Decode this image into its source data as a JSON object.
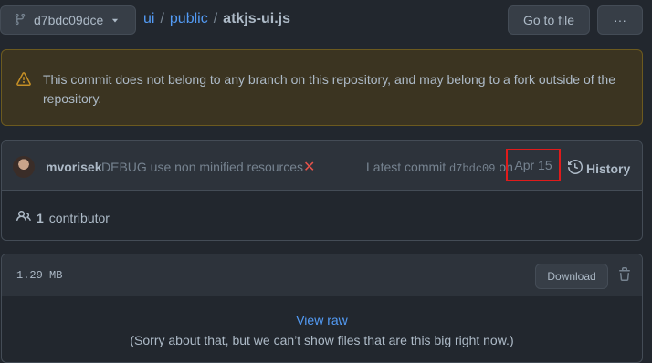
{
  "branch": {
    "label": "d7bdc09dce",
    "icon": "git-branch-icon"
  },
  "breadcrumb": {
    "repo": "ui",
    "sep": "/",
    "folder": "public",
    "file": "atkjs-ui.js"
  },
  "toolbar": {
    "goto_label": "Go to file",
    "more_label": "···"
  },
  "flash": {
    "text": "This commit does not belong to any branch on this repository, and may belong to a fork outside of the repository.",
    "icon": "alert-icon",
    "color": "#c69026"
  },
  "commit": {
    "author": "mvorisek",
    "message": "DEBUG use non minified resources",
    "status": "✕",
    "latest_prefix": "Latest commit",
    "sha": "d7bdc09",
    "on": "on",
    "date": "Apr 15",
    "history_label": "History"
  },
  "contributors": {
    "count": "1",
    "label": "contributor"
  },
  "file": {
    "size": "1.29 MB",
    "download_label": "Download",
    "view_raw": "View raw",
    "too_big": "(Sorry about that, but we can’t show files that are this big right now.)"
  },
  "colors": {
    "background": "#22272e",
    "link": "#539bf5",
    "error": "#e5534b",
    "highlight": "#e01b1b"
  }
}
